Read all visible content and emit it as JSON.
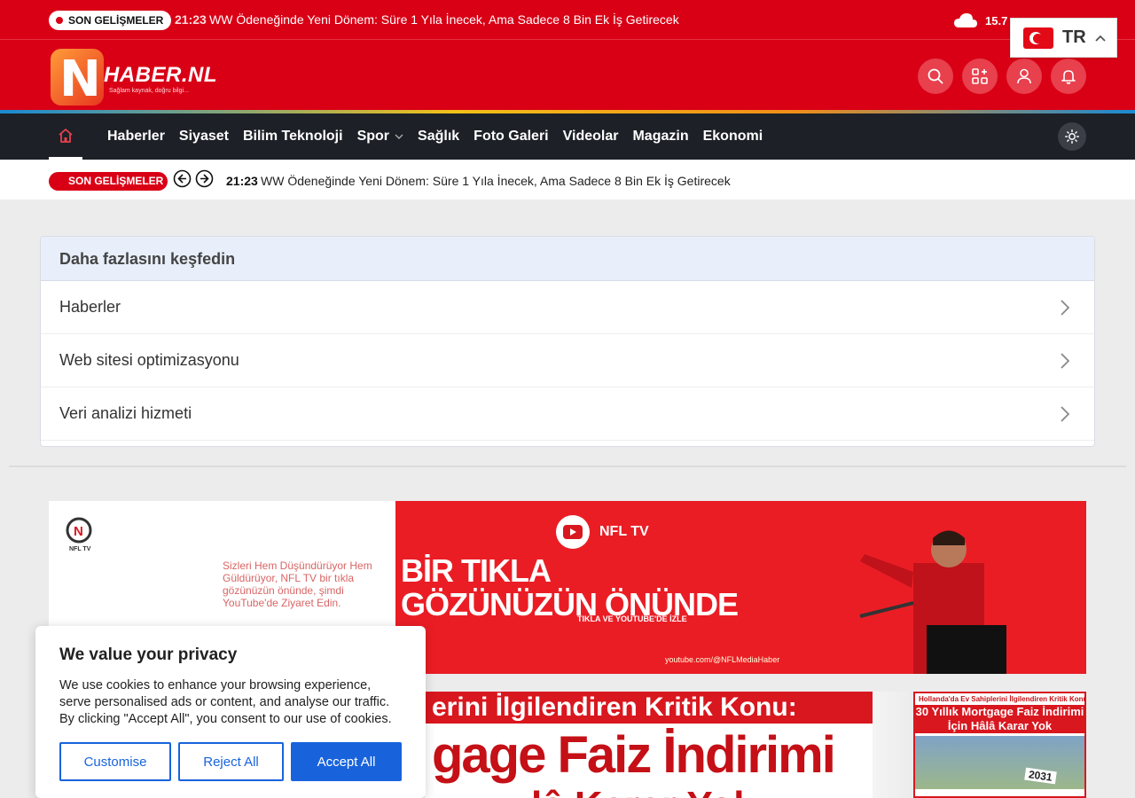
{
  "topbar": {
    "breaking_label": "SON GELİŞMELER",
    "time": "21:23",
    "headline": "WW Ödeneğinde Yeni Dönem: Süre 1 Yıla İnecek, Ama Sadece 8 Bin Ek İş Getirecek",
    "weather_temp": "15.7",
    "weather_icon": "cloud-icon"
  },
  "header": {
    "logo_text": "HABER.NL",
    "logo_tagline": "Sağlam kaynak, doğru bilgi...",
    "accent_color": "#d90016"
  },
  "language": {
    "code": "TR",
    "flag": "turkey-flag"
  },
  "nav": {
    "items": [
      {
        "label": "Haberler"
      },
      {
        "label": "Siyaset"
      },
      {
        "label": "Bilim Teknoloji"
      },
      {
        "label": "Spor"
      },
      {
        "label": "Sağlık"
      },
      {
        "label": "Foto Galeri"
      },
      {
        "label": "Videolar"
      },
      {
        "label": "Magazin"
      },
      {
        "label": "Ekonomi"
      }
    ]
  },
  "ticker": {
    "label": "SON GELİŞMELER",
    "time": "21:23",
    "headline": "WW Ödeneğinde Yeni Dönem: Süre 1 Yıla İnecek, Ama Sadece 8 Bin Ek İş Getirecek"
  },
  "explore": {
    "title": "Daha fazlasını keşfedin",
    "items": [
      {
        "label": "Haberler"
      },
      {
        "label": "Web sitesi optimizasyonu"
      },
      {
        "label": "Veri analizi hizmeti"
      }
    ]
  },
  "banner": {
    "brand": "NFL TV",
    "intro": "Sizleri Hem Düşündürüyor Hem Güldürüyor, NFL TV bir tıkla gözünüzün önünde, şimdi YouTube'de Ziyaret Edin.",
    "headline_1": "BİR TIKLA",
    "headline_2": "GÖZÜNÜZÜN ÖNÜNDE",
    "subline": "TIKLA VE YOUTUBE'DE İZLE",
    "url": "youtube.com/@NFLMediaHaber"
  },
  "promo_main": {
    "line1": "erini İlgilendiren Kritik Konu:",
    "line2": "gage Faiz İndirimi",
    "line3": "lâ Karar Yok"
  },
  "promo_side": {
    "line1": "Hollanda'da Ev Sahiplerini İlgilendiren Kritik Konu:",
    "line2": "30 Yıllık Mortgage Faiz İndirimi",
    "line3": "İçin Hâlâ Karar Yok",
    "year": "2031"
  },
  "cookie": {
    "title": "We value your privacy",
    "text": "We use cookies to enhance your browsing experience, serve personalised ads or content, and analyse our traffic. By clicking \"Accept All\", you consent to our use of cookies.",
    "customise": "Customise",
    "reject": "Reject All",
    "accept": "Accept All"
  }
}
